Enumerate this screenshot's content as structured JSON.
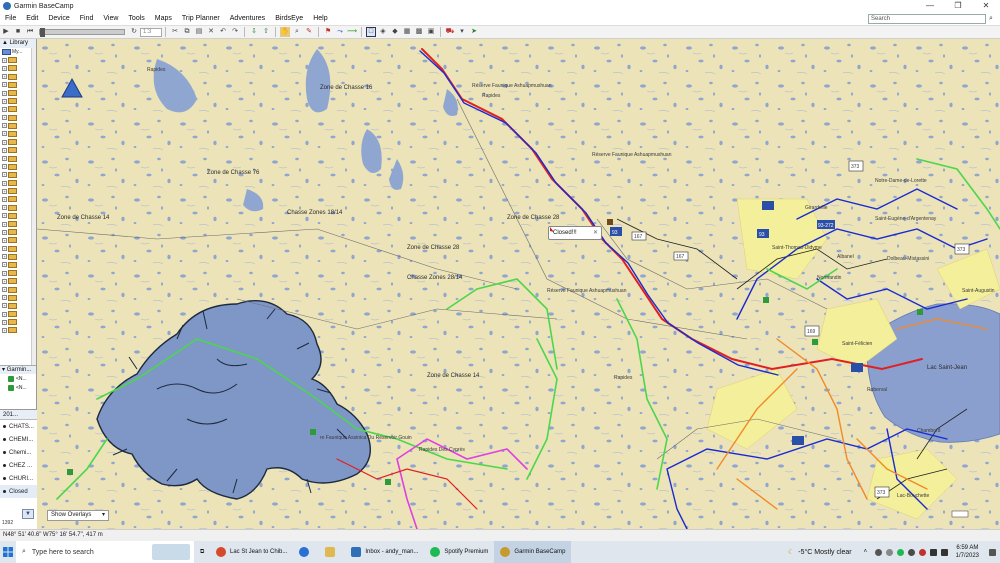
{
  "window": {
    "title": "Garmin BaseCamp",
    "minimize": "—",
    "maximize": "❐",
    "close": "✕"
  },
  "menu": {
    "items": [
      "File",
      "Edit",
      "Device",
      "Find",
      "View",
      "Tools",
      "Maps",
      "Trip Planner",
      "Adventures",
      "BirdsEye",
      "Help"
    ],
    "search_placeholder": "Search"
  },
  "toolbar": {
    "zoom_field": "1:3"
  },
  "library": {
    "title": "Library",
    "root_label": "My...",
    "tree_rows": 34,
    "garmin_section": "Garmin...",
    "devices": [
      "<N...",
      "<N..."
    ]
  },
  "list_panel": {
    "header": "201...",
    "items": [
      "CHATS...",
      "CHEMI...",
      "Chemi...",
      "CHEZ ...",
      "CHURI...",
      "Closed"
    ],
    "count": "1392"
  },
  "map": {
    "callout_label": "Closed!!!",
    "overlay_select": "Show Overlays",
    "labels": {
      "zones": [
        "Zone de Chasse 16",
        "Zone de Chasse 76",
        "Zone de Chasse 14",
        "Zone de Chasse 28",
        "Chasse Zones 18/14",
        "Chasse Zones 28/14",
        "Zone de Chasse 28",
        "Zone de Chasse 14"
      ],
      "reserves": [
        "Réserve Faunique Ashuapmushuan",
        "Réserve Faunique Ashuapmushuan",
        "Réserve Faunique Ashuapmushuan",
        "re Faunique Assinica Du Réservoir Gouin",
        "Rapides Des Cyprès"
      ],
      "towns": [
        "Notre-Dame-de-Lorette",
        "Saint-Eugène-d'Argentenay",
        "Dolbeau-Mistassini",
        "Normandin",
        "Saint-Augustin",
        "Lac-Bouchette",
        "Saint-Félicien",
        "Roberval",
        "Chambord",
        "Albanel",
        "Girardville",
        "Saint-Thomas-Didyme"
      ],
      "roads": [
        "167",
        "167",
        "93",
        "93",
        "373",
        "373",
        "169",
        "373",
        "93-272"
      ],
      "lake": "Lac Saint-Jean",
      "misc": [
        "Rapides",
        "Rapides",
        "Rapides"
      ]
    }
  },
  "status": {
    "coords": "N48° 51' 40.6\" W75° 16' 54.7\", 417 m"
  },
  "taskbar": {
    "search_placeholder": "Type here to search",
    "tasks": [
      {
        "label": "Lac St Jean to Chib...",
        "color": "#d44a2a"
      },
      {
        "label": "",
        "color": "#2a6fd4"
      },
      {
        "label": "",
        "color": "#e0b850"
      },
      {
        "label": "Inbox - andy_man...",
        "color": "#2f6fb7"
      },
      {
        "label": "Spotify Premium",
        "color": "#1db954"
      },
      {
        "label": "Garmin BaseCamp",
        "color": "#c79a2d"
      }
    ],
    "weather": "-5°C  Mostly clear",
    "time": "6:59 AM",
    "date": "1/7/2023"
  },
  "colors": {
    "map_bg": "#ece3b8",
    "water": "#7f97c7",
    "lake_deep": "#8a9fce",
    "route_red": "#e02020",
    "route_blue": "#1a2bd1",
    "route_green": "#4cd64c",
    "route_magenta": "#e040e0",
    "route_orange": "#f08a2a",
    "urban": "#f4ef9a"
  }
}
